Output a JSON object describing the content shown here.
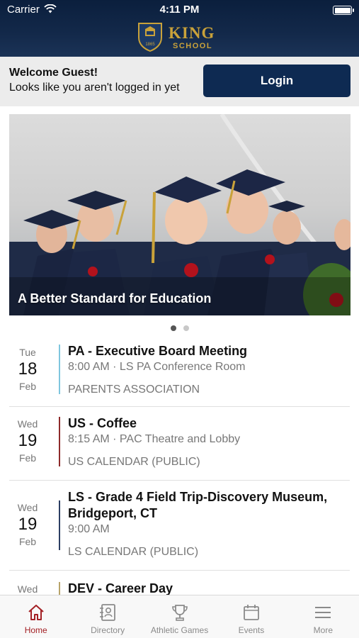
{
  "status_bar": {
    "carrier": "Carrier",
    "time": "4:11 PM"
  },
  "header": {
    "logo_line1": "KING",
    "logo_line2": "SCHOOL",
    "crest_year": "1865"
  },
  "welcome": {
    "greeting": "Welcome Guest!",
    "subtext": "Looks like you aren't logged in yet",
    "login_label": "Login"
  },
  "hero": {
    "caption": "A Better Standard for Education",
    "slides": 2,
    "active_slide": 1
  },
  "events": [
    {
      "dow": "Tue",
      "day": "18",
      "month": "Feb",
      "title": "PA - Executive Board Meeting",
      "detail": "8:00 AM · LS PA Conference Room",
      "calendar": "PARENTS ASSOCIATION",
      "color": "#7fc6de"
    },
    {
      "dow": "Wed",
      "day": "19",
      "month": "Feb",
      "title": "US - Coffee",
      "detail": "8:15 AM · PAC Theatre and Lobby",
      "calendar": "US CALENDAR (PUBLIC)",
      "color": "#8e2a2a"
    },
    {
      "dow": "Wed",
      "day": "19",
      "month": "Feb",
      "title": "LS - Grade 4 Field Trip-Discovery Museum, Bridgeport, CT",
      "detail": "9:00 AM",
      "calendar": "LS CALENDAR (PUBLIC)",
      "color": "#2c3e63"
    },
    {
      "dow": "Wed",
      "day": "",
      "month": "",
      "title": "DEV - Career Day",
      "detail": "",
      "calendar": "",
      "color": "#b8a46a"
    }
  ],
  "tabs": [
    {
      "label": "Home",
      "icon": "home-icon",
      "active": true
    },
    {
      "label": "Directory",
      "icon": "directory-icon",
      "active": false
    },
    {
      "label": "Athletic Games",
      "icon": "trophy-icon",
      "active": false
    },
    {
      "label": "Events",
      "icon": "calendar-icon",
      "active": false
    },
    {
      "label": "More",
      "icon": "menu-icon",
      "active": false
    }
  ],
  "colors": {
    "header_navy": "#0b1f3d",
    "login_button": "#0e2a52",
    "gold": "#c9a23a",
    "active_tab": "#a32024"
  }
}
